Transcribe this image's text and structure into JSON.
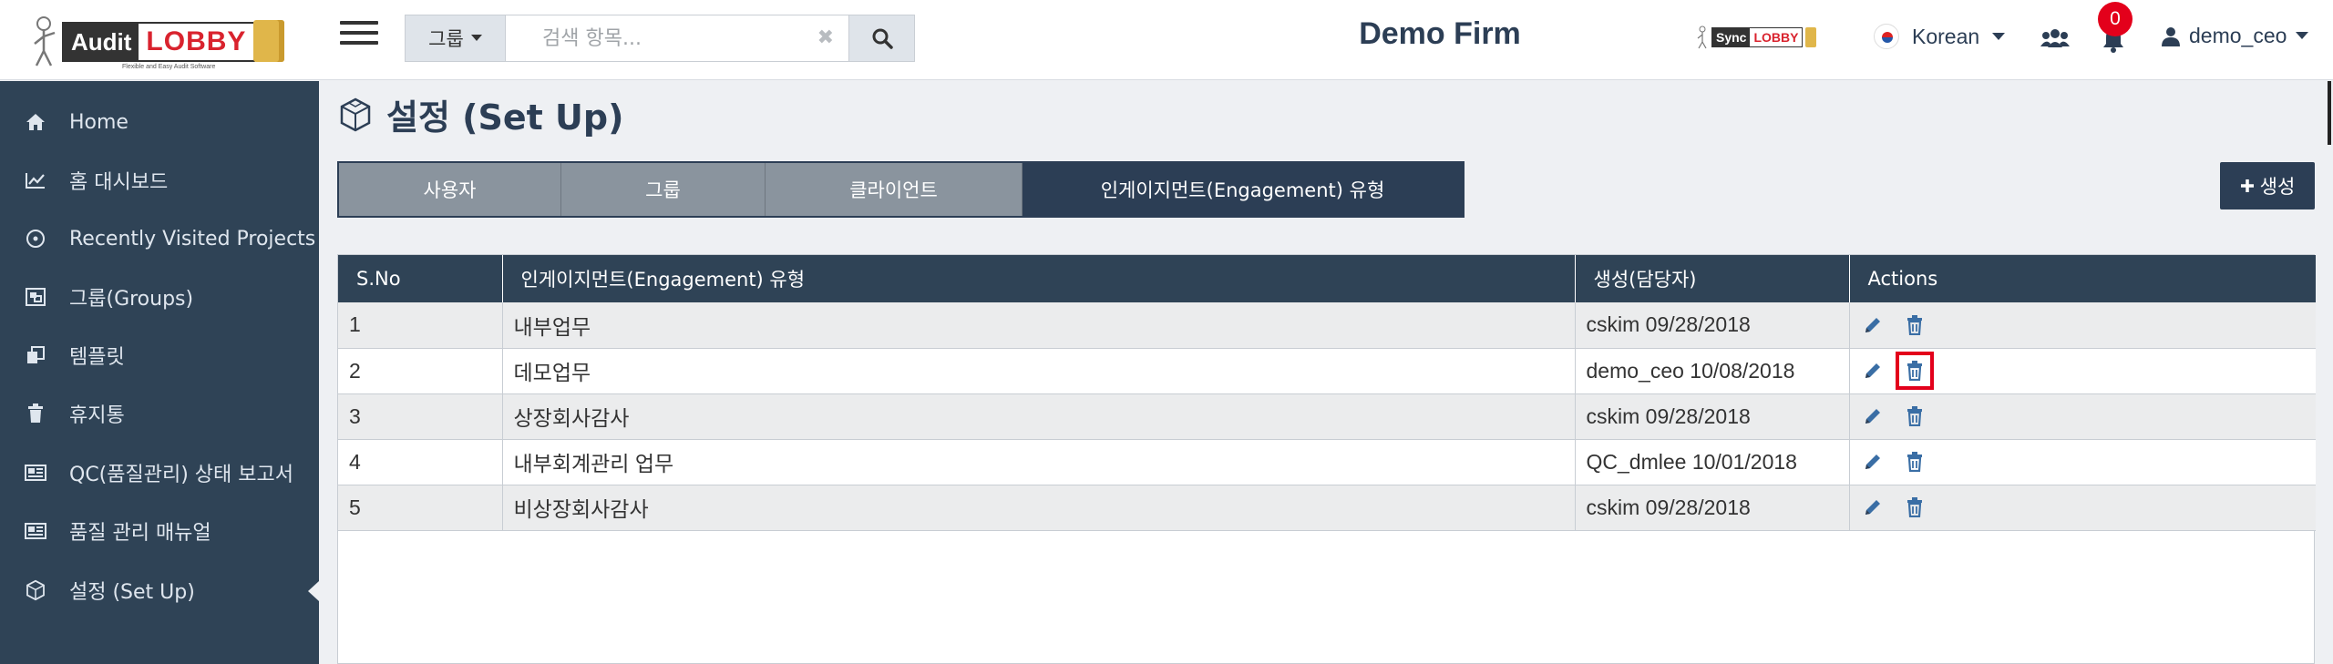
{
  "app": {
    "logo_audit": "Audit",
    "logo_lobby": "LOBBY",
    "logo_tagline": "Flexible and Easy Audit Software",
    "firm_name": "Demo Firm",
    "sync_logo_a": "Sync",
    "sync_logo_b": "LOBBY",
    "language": "Korean",
    "notification_count": "0",
    "username": "demo_ceo"
  },
  "search": {
    "group_label": "그룹",
    "placeholder": "검색 항목..."
  },
  "sidebar": {
    "items": [
      {
        "label": "Home",
        "icon": "home-icon"
      },
      {
        "label": "홈 대시보드",
        "icon": "chart-line-icon"
      },
      {
        "label": "Recently Visited Projects",
        "icon": "clock-icon"
      },
      {
        "label": "그룹(Groups)",
        "icon": "object-group-icon"
      },
      {
        "label": "템플릿",
        "icon": "clone-icon"
      },
      {
        "label": "휴지통",
        "icon": "trash-icon"
      },
      {
        "label": "QC(품질관리) 상태 보고서",
        "icon": "newspaper-icon"
      },
      {
        "label": "품질 관리 매뉴얼",
        "icon": "newspaper-icon"
      },
      {
        "label": "설정 (Set Up)",
        "icon": "cube-icon"
      }
    ],
    "active_index": 8
  },
  "page": {
    "title": "설정 (Set Up)",
    "create_label": "생성",
    "tabs": [
      {
        "label": "사용자"
      },
      {
        "label": "그룹"
      },
      {
        "label": "클라이언트"
      },
      {
        "label": "인게이지먼트(Engagement) 유형"
      }
    ],
    "active_tab": 3
  },
  "table": {
    "headers": [
      "S.No",
      "인게이지먼트(Engagement) 유형",
      "생성(담당자)",
      "Actions"
    ],
    "rows": [
      {
        "sno": "1",
        "type": "내부업무",
        "created": "cskim 09/28/2018"
      },
      {
        "sno": "2",
        "type": "데모업무",
        "created": "demo_ceo 10/08/2018"
      },
      {
        "sno": "3",
        "type": "상장회사감사",
        "created": "cskim 09/28/2018"
      },
      {
        "sno": "4",
        "type": "내부회계관리 업무",
        "created": "QC_dmlee 10/01/2018"
      },
      {
        "sno": "5",
        "type": "비상장회사감사",
        "created": "cskim 09/28/2018"
      }
    ],
    "highlighted_action": "row-2-delete"
  },
  "colors": {
    "sidebar_bg": "#2f4356",
    "header_navy": "#2c3e55",
    "tab_inactive": "#8a949e",
    "highlight_red": "#e3001b"
  }
}
